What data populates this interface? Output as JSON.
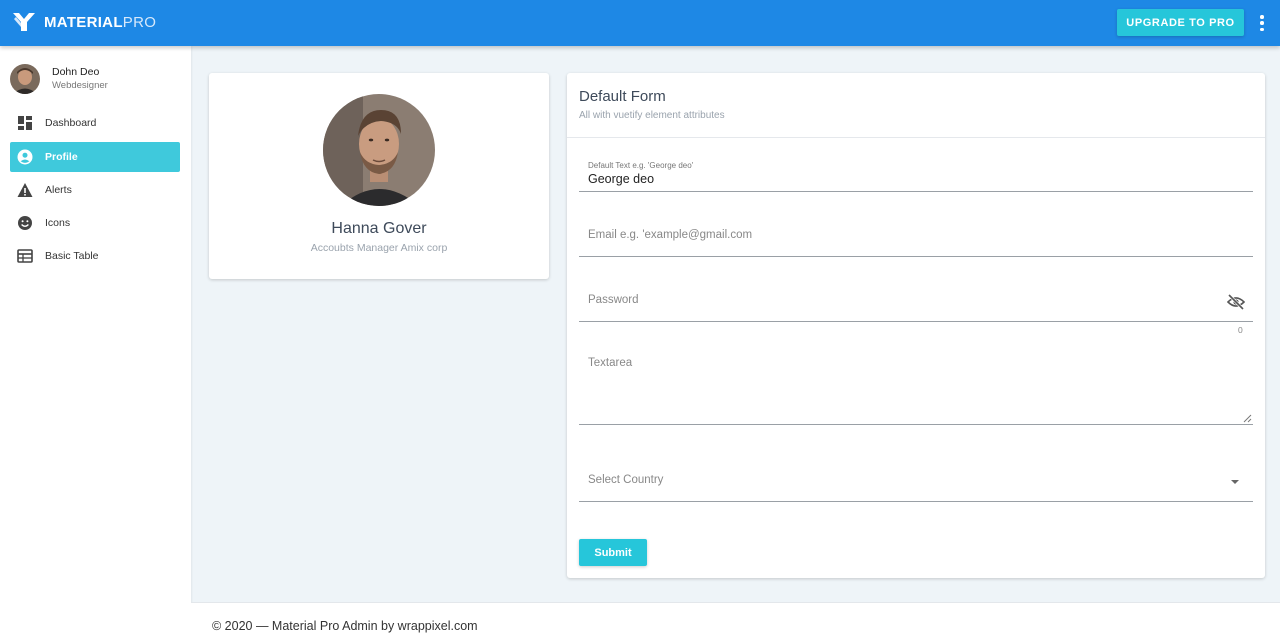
{
  "app": {
    "brand_bold": "MATERIAL",
    "brand_light": "PRO",
    "upgrade_label": "UPGRADE TO PRO",
    "accent_color": "#1e88e5",
    "button_color": "#26c6da"
  },
  "sidebar": {
    "user": {
      "name": "Dohn Deo",
      "role": "Webdesigner"
    },
    "items": [
      {
        "label": "Dashboard",
        "icon": "dashboard-icon",
        "active": false
      },
      {
        "label": "Profile",
        "icon": "account-circle-icon",
        "active": true
      },
      {
        "label": "Alerts",
        "icon": "alert-icon",
        "active": false
      },
      {
        "label": "Icons",
        "icon": "emoticon-icon",
        "active": false
      },
      {
        "label": "Basic Table",
        "icon": "table-icon",
        "active": false
      }
    ]
  },
  "profile": {
    "name": "Hanna Gover",
    "role": "Accoubts Manager Amix corp"
  },
  "form": {
    "title": "Default Form",
    "subtitle": "All with vuetify element attributes",
    "name_label": "Default Text e.g. 'George deo'",
    "name_value": "George deo",
    "email_placeholder": "Email e.g. 'example@gmail.com",
    "password_placeholder": "Password",
    "password_counter": "0",
    "textarea_placeholder": "Textarea",
    "country_placeholder": "Select Country",
    "submit_label": "Submit"
  },
  "footer": {
    "text": "© 2020 — Material Pro Admin by wrappixel.com"
  }
}
